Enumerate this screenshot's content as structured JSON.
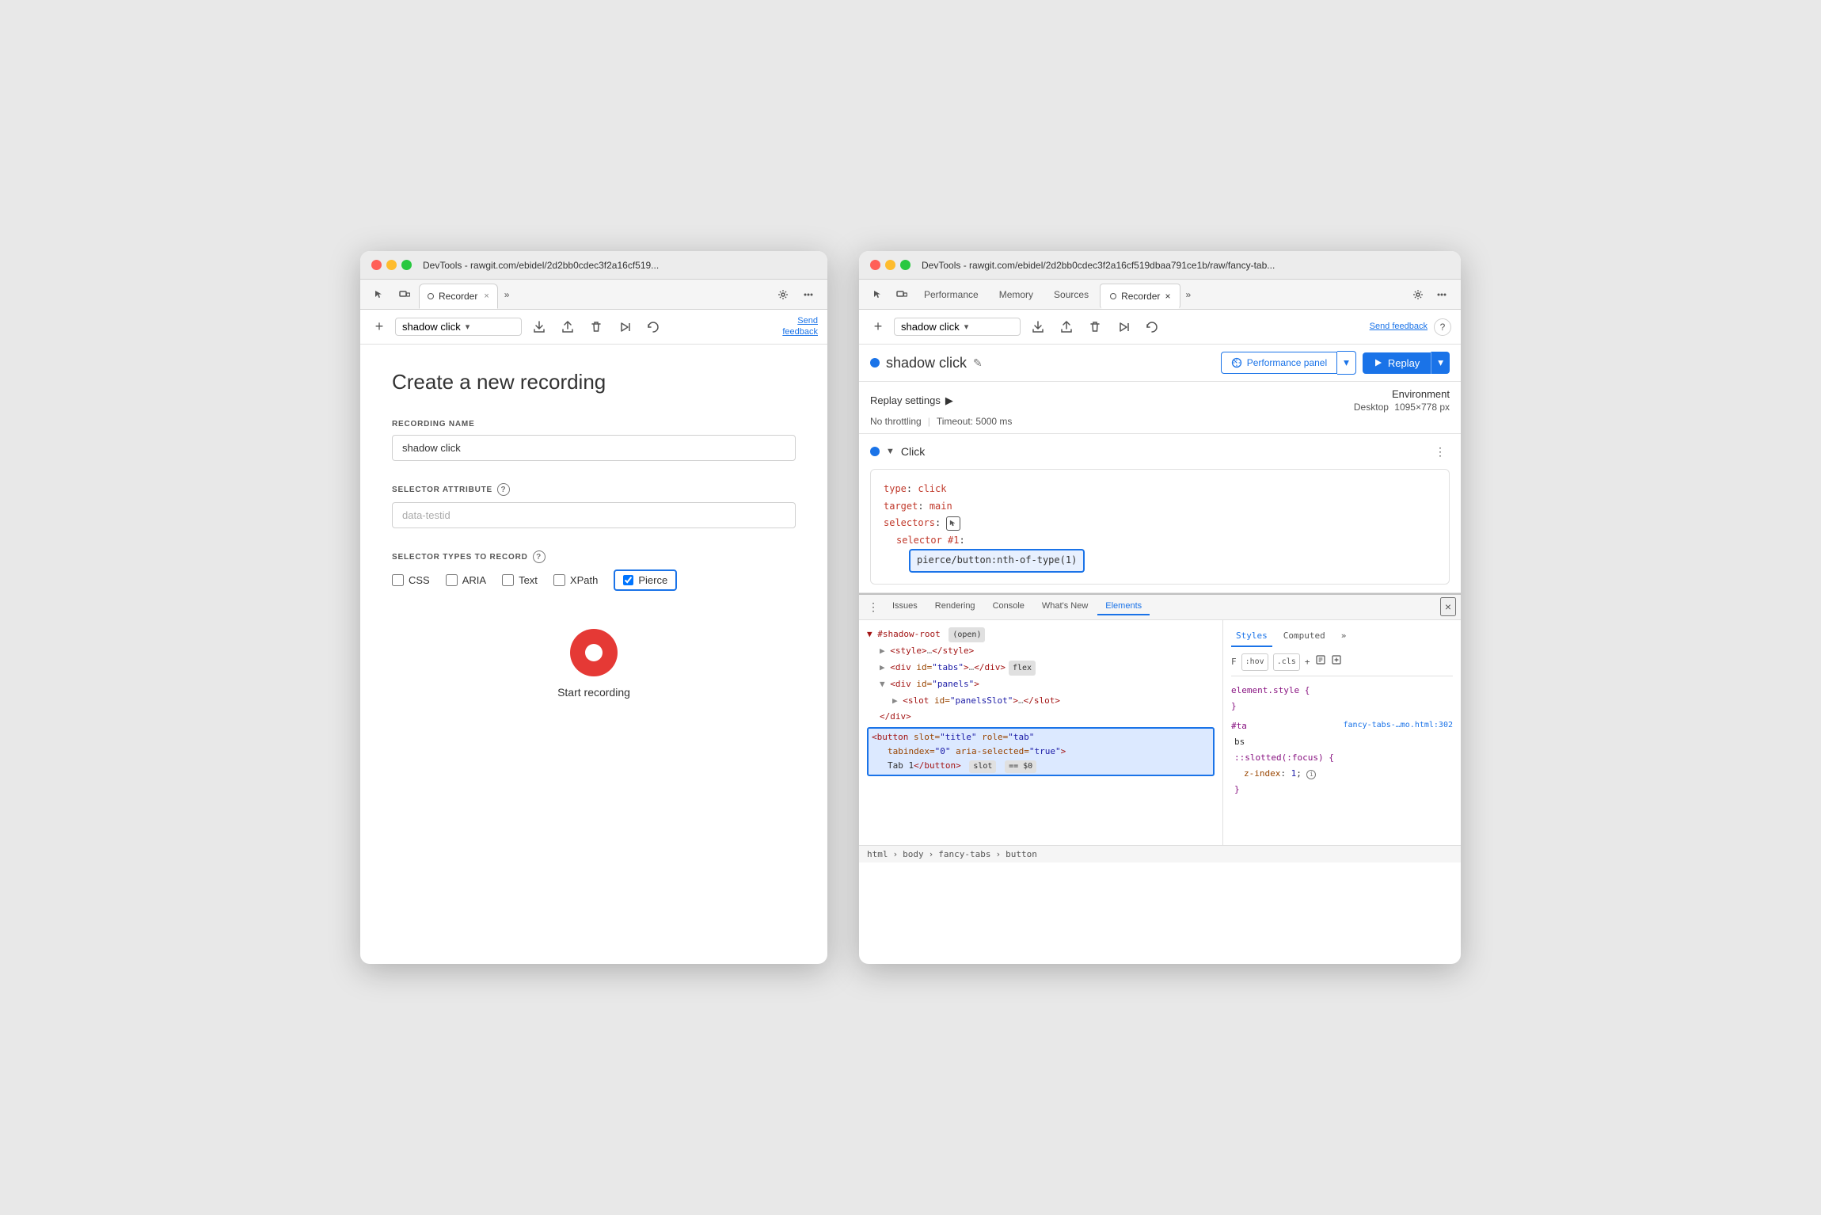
{
  "leftWindow": {
    "titlebar": "DevTools - rawgit.com/ebidel/2d2bb0cdec3f2a16cf519...",
    "tab": {
      "label": "Recorder",
      "record_icon": true,
      "close": "×"
    },
    "toolbar": {
      "add_icon": "+",
      "recording_name": "shadow click",
      "send_feedback": "Send\nfeedback"
    },
    "content": {
      "title": "Create a new recording",
      "recording_name_label": "RECORDING NAME",
      "recording_name_value": "shadow click",
      "selector_attr_label": "SELECTOR ATTRIBUTE",
      "selector_attr_placeholder": "data-testid",
      "selector_types_label": "SELECTOR TYPES TO RECORD",
      "checkboxes": [
        {
          "id": "css",
          "label": "CSS",
          "checked": false
        },
        {
          "id": "aria",
          "label": "ARIA",
          "checked": false
        },
        {
          "id": "text",
          "label": "Text",
          "checked": false
        },
        {
          "id": "xpath",
          "label": "XPath",
          "checked": false
        },
        {
          "id": "pierce",
          "label": "Pierce",
          "checked": true
        }
      ],
      "start_button_label": "Start recording"
    }
  },
  "rightWindow": {
    "titlebar": "DevTools - rawgit.com/ebidel/2d2bb0cdec3f2a16cf519dbaa791ce1b/raw/fancy-tab...",
    "navTabs": [
      {
        "label": "Performance",
        "active": false
      },
      {
        "label": "Memory",
        "active": false
      },
      {
        "label": "Sources",
        "active": false
      },
      {
        "label": "Recorder",
        "active": true
      },
      {
        "label": "more",
        "type": "overflow"
      }
    ],
    "toolbar": {
      "add_icon": "+",
      "recording_name": "shadow click",
      "send_feedback": "Send feedback",
      "help": "?"
    },
    "recorder": {
      "dot_color": "#1a73e8",
      "name": "shadow click",
      "performance_panel_label": "Performance panel",
      "replay_label": "Replay"
    },
    "replaySettings": {
      "title": "Replay settings",
      "expand_icon": "▶",
      "throttling": "No throttling",
      "timeout": "Timeout: 5000 ms",
      "env_label": "Environment",
      "env_value": "Desktop",
      "env_size": "1095×778 px"
    },
    "step": {
      "title": "Click",
      "code": {
        "type_key": "type",
        "type_val": "click",
        "target_key": "target",
        "target_val": "main",
        "selectors_key": "selectors",
        "selector_num_label": "selector #1:",
        "selector_value": "pierce/button:nth-of-type(1)"
      }
    },
    "devtools": {
      "tabs": [
        {
          "label": "Issues",
          "active": false
        },
        {
          "label": "Rendering",
          "active": false
        },
        {
          "label": "Console",
          "active": false
        },
        {
          "label": "What's New",
          "active": false
        },
        {
          "label": "Elements",
          "active": true
        }
      ],
      "elements_tree": [
        {
          "text": "▼ #shadow-root",
          "type": "root",
          "badge": "(open)"
        },
        {
          "text": "  ▶ <style>…</style>",
          "indent": 1
        },
        {
          "text": "  ▶ <div id=\"tabs\">…</div>",
          "indent": 1,
          "badge": "flex"
        },
        {
          "text": "  ▼ <div id=\"panels\">",
          "indent": 1
        },
        {
          "text": "    ▶ <slot id=\"panelsSlot\">…</slot>",
          "indent": 2
        },
        {
          "text": "    </div>",
          "indent": 2
        }
      ],
      "highlighted_element": "<button slot=\"title\" role=\"tab\"\n    tabindex=\"0\" aria-selected=\"true\">\n    Tab 1</button>",
      "highlighted_badges": [
        "slot",
        "== $0"
      ],
      "styles": {
        "tabs": [
          "Styles",
          "Computed"
        ],
        "active_tab": "Styles",
        "toolbar_items": [
          "F",
          ":hov",
          ".cls",
          "+"
        ],
        "rules": [
          {
            "selector": "element.style {",
            "properties": [],
            "closing": "}"
          },
          {
            "selector": "#ta",
            "source": "fancy-tabs-…mo.html:302",
            "source_continuation": "bs",
            "properties": [
              {
                "key": "::slotted(:focus) {"
              }
            ],
            "sub_properties": [
              {
                "key": "z-index",
                "val": "1"
              }
            ],
            "closing": "}"
          }
        ]
      },
      "breadcrumb": [
        "html",
        "body",
        "fancy-tabs",
        "button"
      ]
    }
  }
}
